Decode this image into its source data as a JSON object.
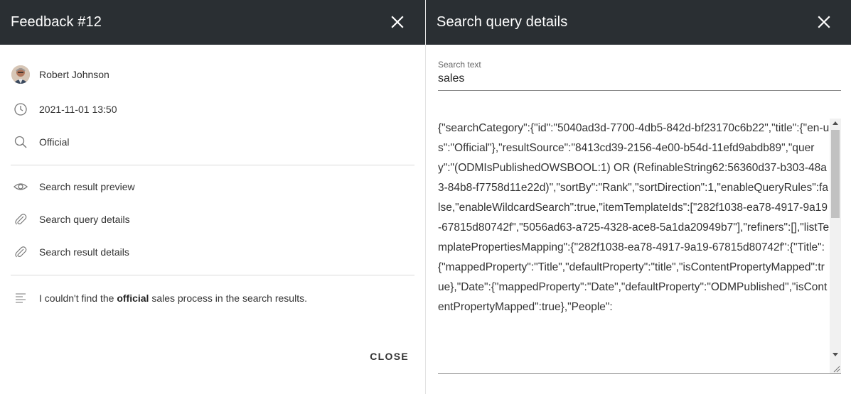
{
  "feedback_panel": {
    "title": "Feedback #12",
    "user": {
      "name": "Robert Johnson",
      "avatar_icon": "user-photo"
    },
    "date": "2021-11-01 13:50",
    "category": "Official",
    "links": [
      {
        "label": "Search result preview",
        "icon": "eye-icon"
      },
      {
        "label": "Search query details",
        "icon": "paperclip-icon"
      },
      {
        "label": "Search result details",
        "icon": "paperclip-icon"
      }
    ],
    "comment": {
      "before": "I couldn't find the ",
      "bold": "official",
      "after": " sales process in the search results."
    },
    "close_label": "CLOSE"
  },
  "details_panel": {
    "title": "Search query details",
    "search_text_label": "Search text",
    "search_text_value": "sales",
    "query_json": "{\"searchCategory\":{\"id\":\"5040ad3d-7700-4db5-842d-bf23170c6b22\",\"title\":{\"en-us\":\"Official\"},\"resultSource\":\"8413cd39-2156-4e00-b54d-11efd9abdb89\",\"query\":\"(ODMIsPublishedOWSBOOL:1) OR (RefinableString62:56360d37-b303-48a3-84b8-f7758d11e22d)\",\"sortBy\":\"Rank\",\"sortDirection\":1,\"enableQueryRules\":false,\"enableWildcardSearch\":true,\"itemTemplateIds\":[\"282f1038-ea78-4917-9a19-67815d80742f\",\"5056ad63-a725-4328-ace8-5a1da20949b7\"],\"refiners\":[],\"listTemplatePropertiesMapping\":{\"282f1038-ea78-4917-9a19-67815d80742f\":{\"Title\":{\"mappedProperty\":\"Title\",\"defaultProperty\":\"title\",\"isContentPropertyMapped\":true},\"Date\":{\"mappedProperty\":\"Date\",\"defaultProperty\":\"ODMPublished\",\"isContentPropertyMapped\":true},\"People\":"
  },
  "colors": {
    "header_bg": "#2a2f33",
    "header_text": "#ffffff",
    "divider": "#d9d9d9"
  }
}
